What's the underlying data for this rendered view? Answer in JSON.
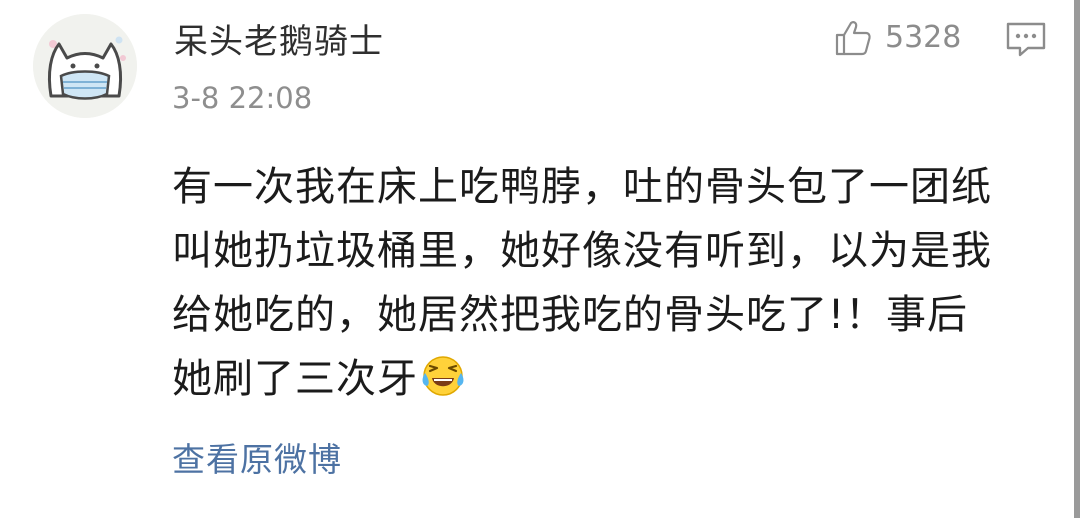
{
  "comment": {
    "author": {
      "name": "呆头老鹅骑士",
      "avatar_icon": "cat-mask-avatar-icon"
    },
    "timestamp": "3-8 22:08",
    "likes": {
      "icon": "thumbs-up-icon",
      "count": "5328"
    },
    "reply_icon": "comment-bubble-icon",
    "text_lines": [
      "有一次我在床上吃鸭脖，吐的骨头包了一团纸",
      "叫她扔垃圾桶里，她好像没有听到，以为是我",
      "给她吃的，她居然把我吃的骨头吃了!！事后",
      "她刷了三次牙"
    ],
    "emoji": "laughing-crying-emoji",
    "view_original_label": "查看原微博"
  },
  "colors": {
    "text_primary": "#1b1b1b",
    "text_secondary": "#8e8e8e",
    "link": "#4d72a3",
    "icon_gray": "#8c8c8c"
  }
}
